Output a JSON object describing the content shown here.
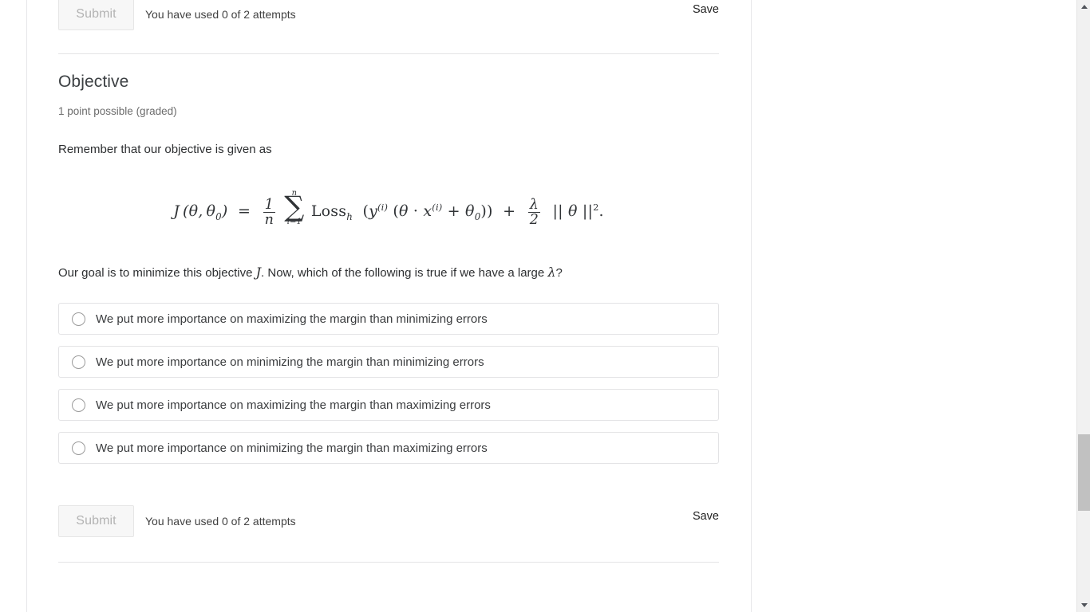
{
  "top_submit": {
    "button_label": "Submit",
    "attempts_text": "You have used 0 of 2 attempts",
    "save_label": "Save"
  },
  "problem": {
    "title": "Objective",
    "points": "1 point possible (graded)",
    "intro": "Remember that our objective is given as",
    "formula": {
      "lhs_J": "J",
      "lhs_args": "(θ, θ₀)",
      "equals": "=",
      "frac1_num": "1",
      "frac1_den": "n",
      "sum_upper": "n",
      "sum_symbol": "∑",
      "sum_lower": "i=1",
      "loss_name": "Loss",
      "loss_sub": "h",
      "inner": "(y⁽ⁱ⁾ (θ · x⁽ⁱ⁾ + θ₀))",
      "plus": "+",
      "frac2_num": "λ",
      "frac2_den": "2",
      "norm": "|| θ ||²",
      "period": ".",
      "plain_text": "J (θ, θ₀) = (1/n) Σ_{i=1}^{n} Loss_h (y^(i) (θ · x^(i) + θ₀)) + (λ/2) || θ ||²."
    },
    "question_part1": "Our goal is to minimize this objective ",
    "question_symbol_J": "J",
    "question_part2": ". Now, which of the following is true if we have a large ",
    "question_symbol_lambda": "λ",
    "question_part3": "?",
    "choices": [
      {
        "id": "choice-1",
        "label": "We put more importance on maximizing the margin than minimizing errors",
        "selected": false
      },
      {
        "id": "choice-2",
        "label": "We put more importance on minimizing the margin than minimizing errors",
        "selected": false
      },
      {
        "id": "choice-3",
        "label": "We put more importance on maximizing the margin than maximizing errors",
        "selected": false
      },
      {
        "id": "choice-4",
        "label": "We put more importance on minimizing the margin than maximizing errors",
        "selected": false
      }
    ]
  },
  "bottom_submit": {
    "button_label": "Submit",
    "attempts_text": "You have used 0 of 2 attempts",
    "save_label": "Save"
  },
  "colors": {
    "page_background": "#ffffff",
    "divider": "#e4e4e6",
    "choice_border": "#e3e3e5",
    "submit_disabled_bg": "#f7f7f7",
    "submit_disabled_text": "#b3b3b3",
    "body_text": "#2d2f31",
    "muted_text": "#6c6c6c",
    "scrollbar_track": "#f1f1f1",
    "scrollbar_thumb": "#c1c1c1"
  }
}
